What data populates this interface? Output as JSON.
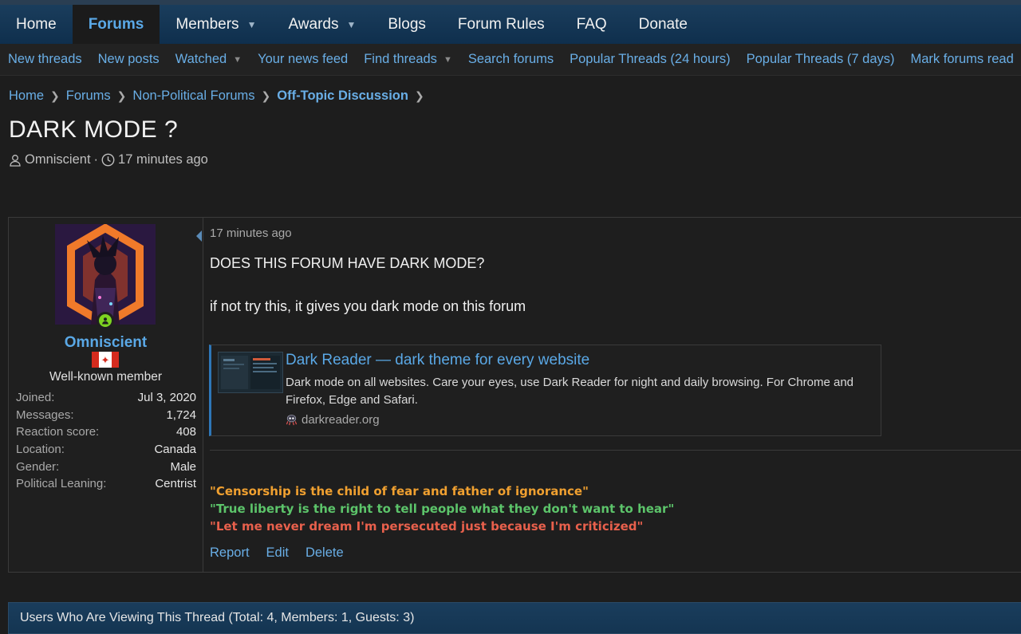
{
  "nav": {
    "tabs": [
      {
        "label": "Home",
        "dropdown": false
      },
      {
        "label": "Forums",
        "dropdown": false,
        "active": true
      },
      {
        "label": "Members",
        "dropdown": true
      },
      {
        "label": "Awards",
        "dropdown": true
      },
      {
        "label": "Blogs",
        "dropdown": false
      },
      {
        "label": "Forum Rules",
        "dropdown": false
      },
      {
        "label": "FAQ",
        "dropdown": false
      },
      {
        "label": "Donate",
        "dropdown": false
      }
    ]
  },
  "subnav": {
    "items": [
      {
        "label": "New threads",
        "dropdown": false
      },
      {
        "label": "New posts",
        "dropdown": false
      },
      {
        "label": "Watched",
        "dropdown": true
      },
      {
        "label": "Your news feed",
        "dropdown": false
      },
      {
        "label": "Find threads",
        "dropdown": true
      },
      {
        "label": "Search forums",
        "dropdown": false
      },
      {
        "label": "Popular Threads (24 hours)",
        "dropdown": false
      },
      {
        "label": "Popular Threads (7 days)",
        "dropdown": false
      },
      {
        "label": "Mark forums read",
        "dropdown": false
      }
    ]
  },
  "breadcrumb": {
    "items": [
      "Home",
      "Forums",
      "Non-Political Forums",
      "Off-Topic Discussion"
    ]
  },
  "thread": {
    "title": "DARK MODE ?",
    "author": "Omniscient",
    "time": "17 minutes ago"
  },
  "post": {
    "user": {
      "name": "Omniscient",
      "title": "Well-known member",
      "flag": "canada-flag-icon",
      "stats": [
        {
          "label": "Joined:",
          "value": "Jul 3, 2020"
        },
        {
          "label": "Messages:",
          "value": "1,724"
        },
        {
          "label": "Reaction score:",
          "value": "408"
        },
        {
          "label": "Location:",
          "value": "Canada"
        },
        {
          "label": "Gender:",
          "value": "Male"
        },
        {
          "label": "Political Leaning:",
          "value": "Centrist"
        }
      ]
    },
    "timestamp": "17 minutes ago",
    "body": {
      "line1": "DOES THIS FORUM HAVE DARK MODE?",
      "line2": "if not try this, it gives you dark mode on this forum"
    },
    "unfurl": {
      "title": "Dark Reader — dark theme for every website",
      "description": "Dark mode on all websites. Care your eyes, use Dark Reader for night and daily browsing. For Chrome and Firefox, Edge and Safari.",
      "domain": "darkreader.org"
    },
    "signature": [
      {
        "text": "\"Censorship is the child of fear and father of ignorance\"",
        "color": "#f0a030"
      },
      {
        "text": "\"True liberty is the right to tell people what they don't want to hear\"",
        "color": "#5cc46a"
      },
      {
        "text": "\"Let me never dream I'm persecuted just because I'm criticized\"",
        "color": "#e8604c"
      }
    ],
    "actions": [
      "Report",
      "Edit",
      "Delete"
    ]
  },
  "viewers": {
    "label": "Users Who Are Viewing This Thread (Total: 4, Members: 1, Guests: 3)"
  },
  "colors": {
    "accent": "#5aa8e6",
    "link": "#69aee6",
    "nav_bg": "#1a3d5c",
    "online": "#7ed321"
  }
}
